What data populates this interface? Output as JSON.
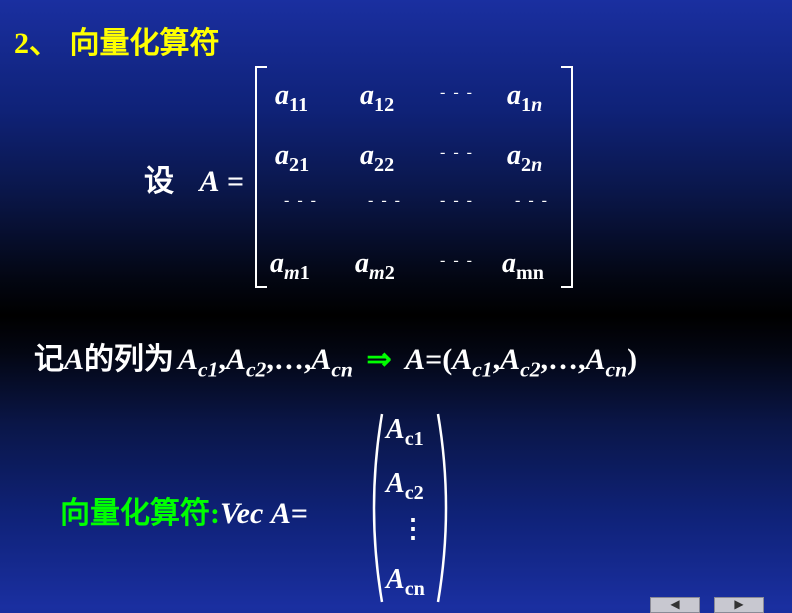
{
  "heading": {
    "number": "2、",
    "title": "向量化算符"
  },
  "definition": {
    "prefix": "设",
    "var": "A",
    "eq": "="
  },
  "matrix": {
    "r1": [
      "a",
      "11",
      "a",
      "12",
      "- - -",
      "a",
      "1",
      "n"
    ],
    "r2": [
      "a",
      "21",
      "a",
      "22",
      "- - -",
      "a",
      "2",
      "n"
    ],
    "r3": [
      "- - -",
      "- - -",
      "- - -",
      "- - -"
    ],
    "r4": [
      "a",
      "m",
      "1",
      "a",
      "m",
      "2",
      "- - -",
      "a",
      "mn"
    ]
  },
  "columns_line": {
    "intro": "记",
    "var": "A",
    "text": "的列为",
    "implies": "⇒",
    "lhs": "A",
    "eq": "=",
    "open": "(",
    "close": ")",
    "A": "A",
    "c1": "c1",
    "c2": "c2",
    "cn": "cn",
    "comma": ",",
    "ellipsis": "…"
  },
  "vec": {
    "label": "向量化算符",
    "colon": ":",
    "op": "Vec",
    "var": "A",
    "eq": "=",
    "entries": [
      "A",
      "c1",
      "A",
      "c2",
      "A",
      "cn"
    ],
    "vdots": "⋮"
  },
  "nav": {
    "prev": "◀",
    "next": "▶"
  },
  "colors": {
    "heading": "#ffff00",
    "vec_label": "#00ff00",
    "text": "#ffffff",
    "implies": "#00ff00"
  }
}
